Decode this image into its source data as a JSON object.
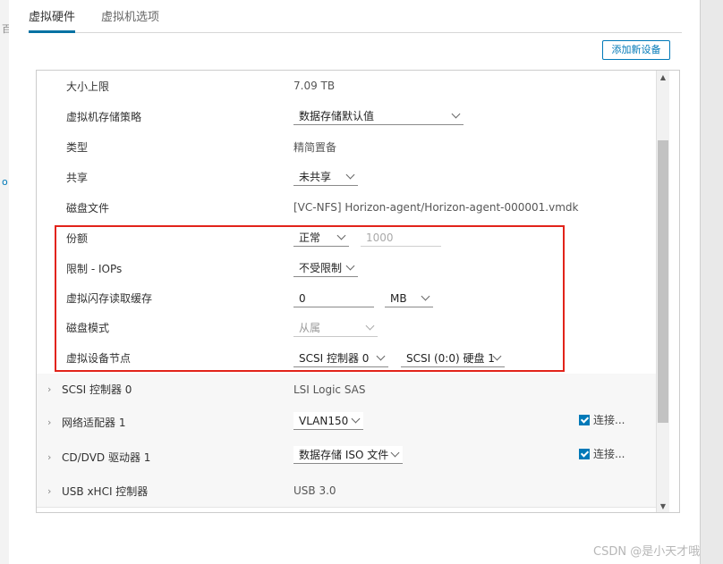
{
  "tabs": [
    "虚拟硬件",
    "虚拟机选项"
  ],
  "add_device_button": "添加新设备",
  "left_marks": [
    "百",
    "o"
  ],
  "rows": {
    "size_limit": {
      "label": "大小上限",
      "value": "7.09 TB"
    },
    "storage_policy": {
      "label": "虚拟机存储策略",
      "value": "数据存储默认值"
    },
    "type": {
      "label": "类型",
      "value": "精简置备"
    },
    "sharing": {
      "label": "共享",
      "value": "未共享"
    },
    "disk_file": {
      "label": "磁盘文件",
      "value": "[VC-NFS] Horizon-agent/Horizon-agent-000001.vmdk"
    },
    "shares": {
      "label": "份额",
      "value": "正常",
      "input": "1000"
    },
    "limit_iops": {
      "label": "限制 - IOPs",
      "value": "不受限制"
    },
    "flash_cache": {
      "label": "虚拟闪存读取缓存",
      "value": "0",
      "unit": "MB"
    },
    "disk_mode": {
      "label": "磁盘模式",
      "value": "从属"
    },
    "device_node": {
      "label": "虚拟设备节点",
      "controller": "SCSI 控制器 0",
      "node": "SCSI (0:0) 硬盘 1"
    }
  },
  "sections": {
    "scsi": {
      "label": "SCSI 控制器 0",
      "value": "LSI Logic SAS"
    },
    "network": {
      "label": "网络适配器 1",
      "value": "VLAN150",
      "connect": "连接..."
    },
    "cddvd": {
      "label": "CD/DVD 驱动器 1",
      "value": "数据存储 ISO 文件",
      "connect": "连接..."
    },
    "usb": {
      "label": "USB xHCI 控制器",
      "value": "USB 3.0"
    }
  },
  "watermark": "CSDN @是小天才哦",
  "colors": {
    "accent": "#0079b8",
    "highlight": "#e2231a"
  }
}
